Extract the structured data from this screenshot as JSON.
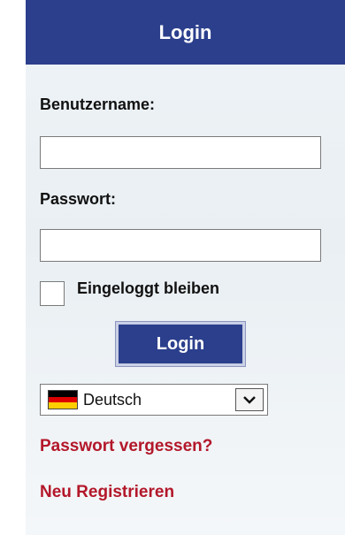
{
  "header": {
    "title": "Login"
  },
  "form": {
    "username_label": "Benutzername:",
    "username_value": "",
    "password_label": "Passwort:",
    "password_value": "",
    "remember_label": "Eingeloggt bleiben",
    "remember_checked": false,
    "login_button_label": "Login"
  },
  "language": {
    "selected": "Deutsch",
    "flag_icon": "germany-flag-icon",
    "chevron_icon": "chevron-down-icon"
  },
  "links": {
    "forgot_password": "Passwort vergessen?",
    "register": "Neu Registrieren"
  },
  "colors": {
    "header_bg": "#2b3f8c",
    "link_color": "#b3172a",
    "panel_bg": "#eef3f6"
  }
}
